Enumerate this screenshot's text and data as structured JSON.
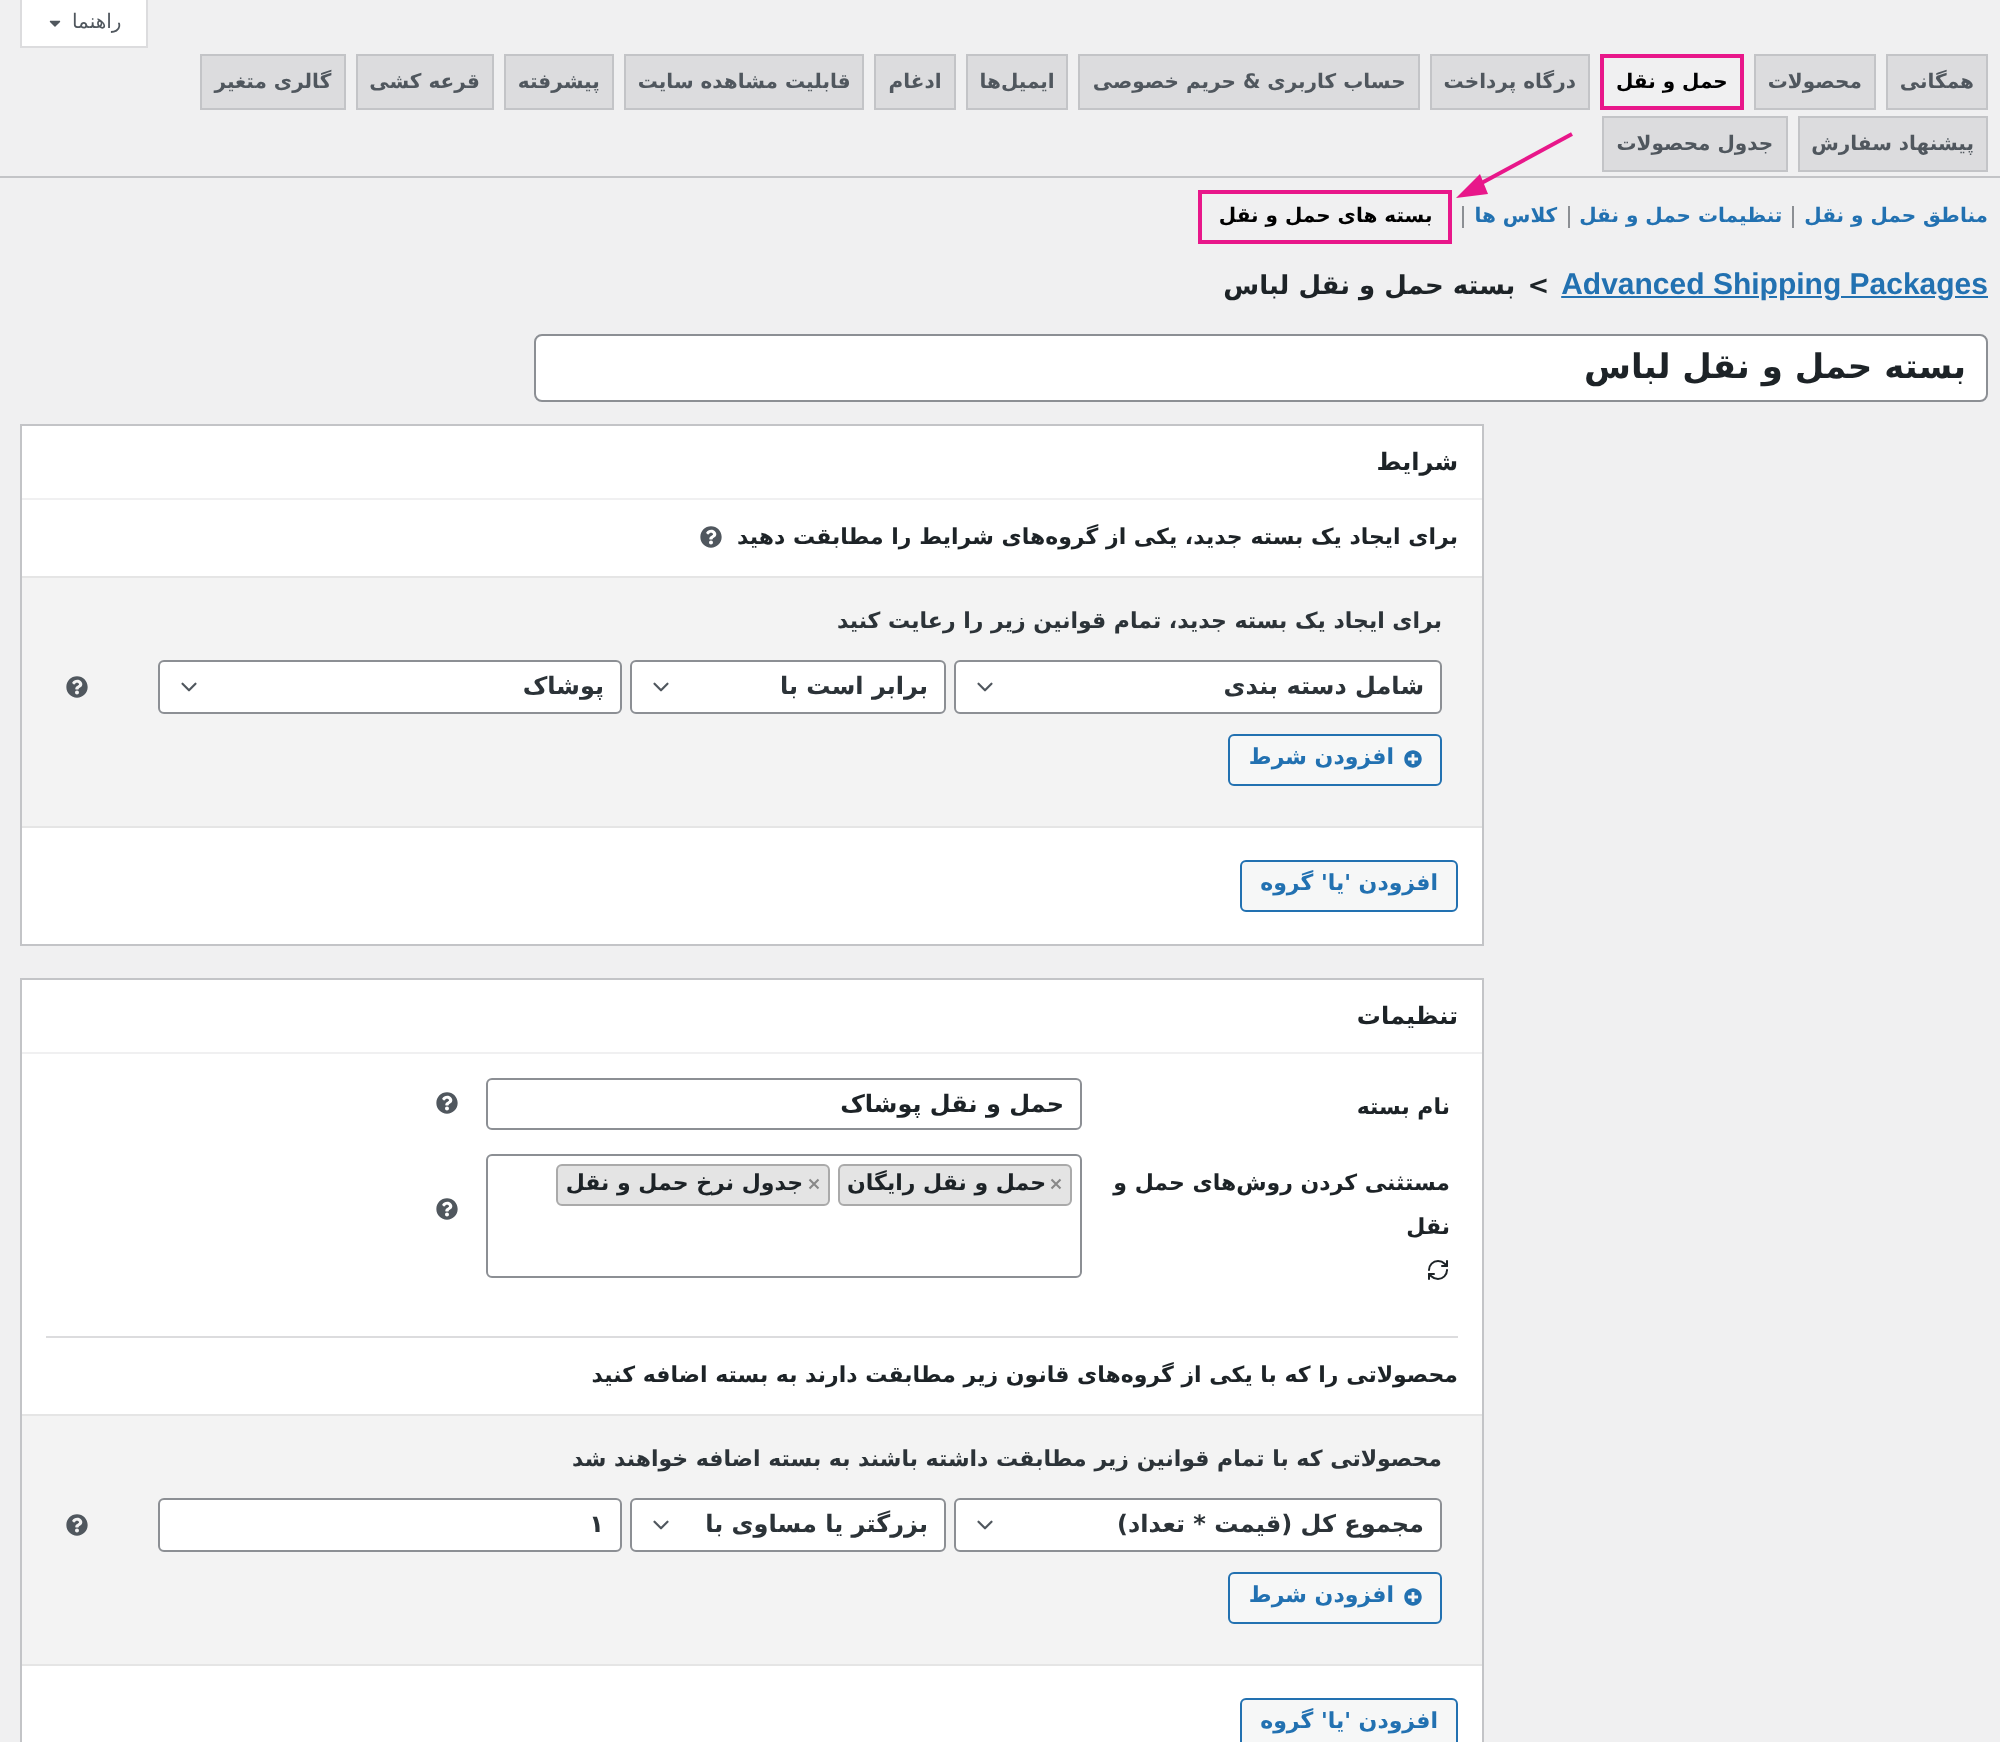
{
  "help_button": {
    "label": "راهنما"
  },
  "tab_rows": [
    [
      {
        "label": "همگانی",
        "selected": false
      },
      {
        "label": "محصولات",
        "selected": false
      },
      {
        "label": "حمل و نقل",
        "selected": true
      },
      {
        "label": "درگاه پرداخت",
        "selected": false
      },
      {
        "label": "حساب کاربری & حریم خصوصی",
        "selected": false
      },
      {
        "label": "ایمیل‌ها",
        "selected": false
      },
      {
        "label": "ادغام",
        "selected": false
      },
      {
        "label": "قابلیت مشاهده سایت",
        "selected": false
      },
      {
        "label": "پیشرفته",
        "selected": false
      },
      {
        "label": "قرعه کشی",
        "selected": false
      },
      {
        "label": "گالری متغیر",
        "selected": false
      }
    ],
    [
      {
        "label": "پیشنهاد سفارش",
        "selected": false
      },
      {
        "label": "جدول محصولات",
        "selected": false
      }
    ]
  ],
  "subnav": [
    {
      "label": "مناطق حمل و نقل",
      "selected": false
    },
    {
      "label": "تنظیمات حمل و نقل",
      "selected": false
    },
    {
      "label": "کلاس ها",
      "selected": false
    },
    {
      "label": "بسته های حمل و نقل",
      "selected": true
    }
  ],
  "breadcrumb": {
    "link": "Advanced Shipping Packages",
    "separator": ">",
    "current": "بسته حمل و نقل لباس"
  },
  "title_field": {
    "value": "بسته حمل و نقل لباس"
  },
  "conditions": {
    "title": "شرایط",
    "description": "برای ایجاد یک بسته جدید، یکی از گروه‌های شرایط را مطابقت دهید",
    "group": {
      "intro": "برای ایجاد یک بسته جدید، تمام قوانین زیر را رعایت کنید",
      "fields": [
        {
          "kind": "select",
          "value": "شامل دسته بندی"
        },
        {
          "kind": "select",
          "value": "برابر است با"
        },
        {
          "kind": "select",
          "value": "پوشاک"
        }
      ],
      "add_condition": "افزودن شرط"
    },
    "add_or_group": "افزودن 'یا' گروه"
  },
  "settings": {
    "title": "تنظیمات",
    "fields": [
      {
        "kind": "text",
        "label": "نام بسته",
        "value": "حمل و نقل پوشاک"
      },
      {
        "kind": "tags",
        "label": "مستثنی کردن روش‌های حمل و نقل",
        "tags": [
          "حمل و نقل رایگان",
          "جدول نرخ حمل و نقل"
        ]
      }
    ],
    "products_text": "محصولاتی را که با یکی از گروه‌های قانون زیر مطابقت دارند به بسته اضافه کنید",
    "group": {
      "intro": "محصولاتی که با تمام قوانین زیر مطابقت داشته باشند به بسته اضافه خواهند شد",
      "fields": [
        {
          "kind": "select",
          "value": "مجموع کل (قیمت * تعداد)"
        },
        {
          "kind": "select",
          "value": "بزرگتر یا مساوی با"
        },
        {
          "kind": "input",
          "value": "۱"
        }
      ],
      "add_condition": "افزودن شرط"
    },
    "add_or_group": "افزودن 'یا' گروه"
  }
}
